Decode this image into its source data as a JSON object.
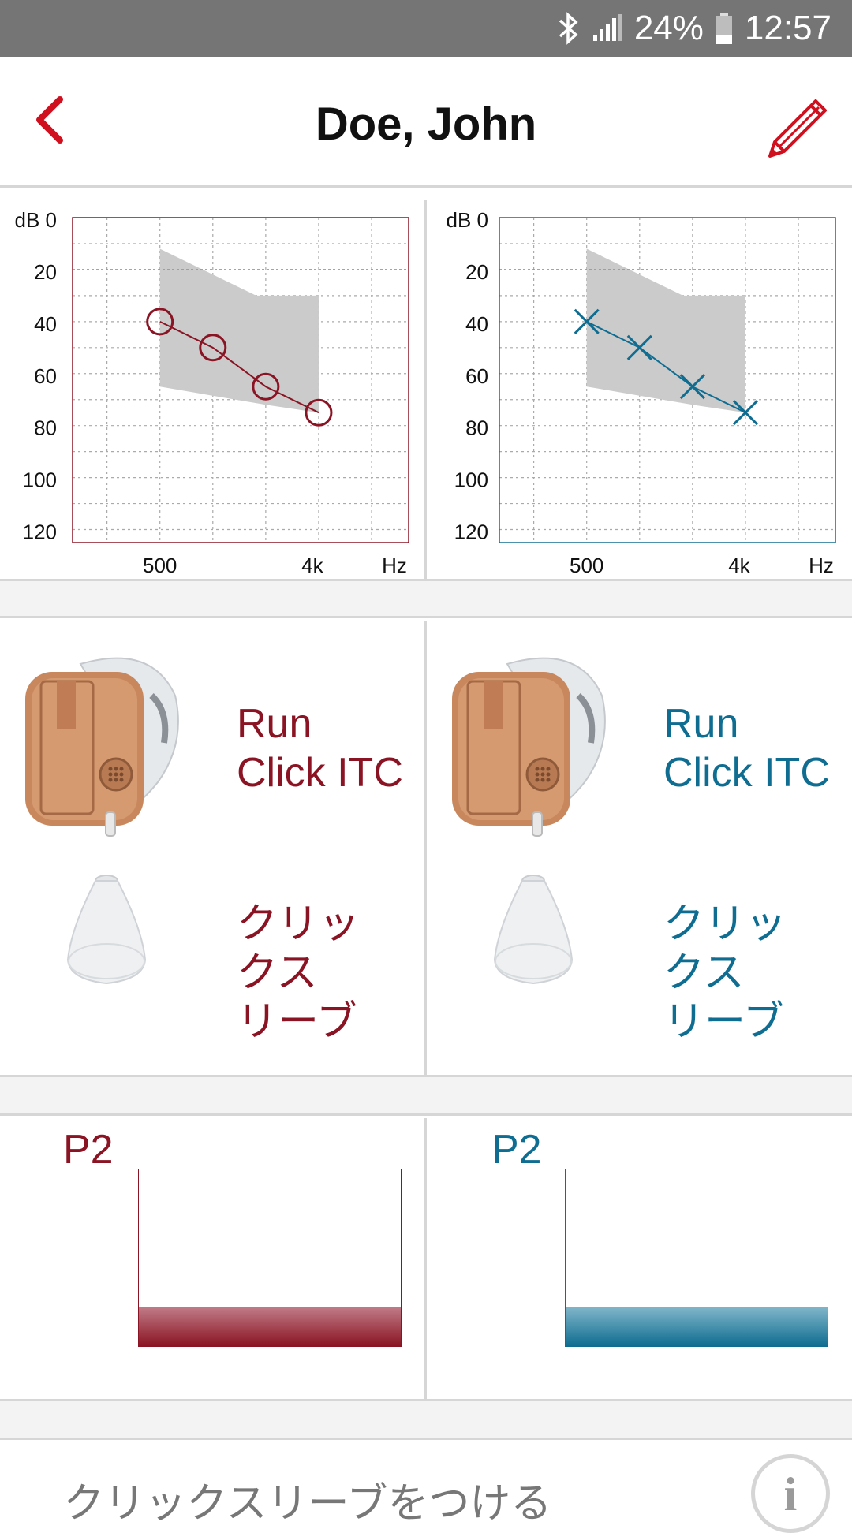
{
  "status_bar": {
    "battery": "24%",
    "time": "12:57"
  },
  "header": {
    "title": "Doe, John"
  },
  "audiograms": {
    "y_ticks": [
      "dB 0",
      "20",
      "40",
      "60",
      "80",
      "100",
      "120"
    ],
    "x_ticks": [
      "500",
      "4k",
      "Hz"
    ],
    "left": {
      "color": "#8a1423",
      "marker": "circle",
      "chart_data": {
        "type": "line",
        "x": [
          "500",
          "1k",
          "2k",
          "4k"
        ],
        "y": [
          40,
          50,
          65,
          75
        ],
        "ylim": [
          0,
          125
        ],
        "reference_line_db": 20,
        "fitting_range": {
          "x": [
            "500",
            "2k",
            "4k"
          ],
          "upper_db": [
            12,
            30,
            30
          ],
          "lower_db": [
            65,
            72,
            75
          ]
        }
      }
    },
    "right": {
      "color": "#0f6d91",
      "marker": "cross",
      "chart_data": {
        "type": "line",
        "x": [
          "500",
          "1k",
          "2k",
          "4k"
        ],
        "y": [
          40,
          50,
          65,
          75
        ],
        "ylim": [
          0,
          125
        ],
        "reference_line_db": 20,
        "fitting_range": {
          "x": [
            "500",
            "2k",
            "4k"
          ],
          "upper_db": [
            12,
            30,
            30
          ],
          "lower_db": [
            65,
            72,
            75
          ]
        }
      }
    }
  },
  "devices": {
    "left": {
      "model_line1": "Run",
      "model_line2": "Click ITC",
      "sleeve_line1": "クリッ",
      "sleeve_line2": "クス",
      "sleeve_line3": "リーブ"
    },
    "right": {
      "model_line1": "Run",
      "model_line2": "Click ITC",
      "sleeve_line1": "クリッ",
      "sleeve_line2": "クス",
      "sleeve_line3": "リーブ"
    }
  },
  "programs": {
    "left": {
      "label": "P2",
      "level_fraction": 0.22
    },
    "right": {
      "label": "P2",
      "level_fraction": 0.22
    }
  },
  "footer": {
    "instruction": "クリックスリーブをつける",
    "info_icon": "i"
  }
}
